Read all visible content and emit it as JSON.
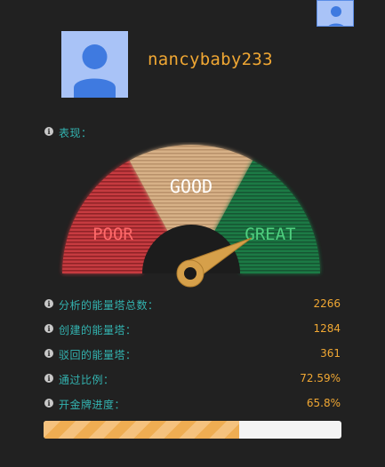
{
  "user": {
    "name": "nancybaby233",
    "avatar_icon": "user-icon"
  },
  "performance_label": "表现：",
  "gauge": {
    "poor_label": "POOR",
    "good_label": "GOOD",
    "great_label": "GREAT",
    "colors": {
      "poor": "#c63b3f",
      "good": "#d7b187",
      "great": "#1f7a45"
    }
  },
  "stats": [
    {
      "label": "分析的能量塔总数：",
      "value": "2266"
    },
    {
      "label": "创建的能量塔：",
      "value": "1284"
    },
    {
      "label": "驳回的能量塔：",
      "value": "361"
    },
    {
      "label": "通过比例：",
      "value": "72.59%"
    },
    {
      "label": "开金牌进度：",
      "value": "65.8%"
    }
  ],
  "progress": {
    "percent": 65.8
  },
  "colors": {
    "accent": "#f0a733",
    "label": "#33b3b0",
    "background": "#212121"
  }
}
